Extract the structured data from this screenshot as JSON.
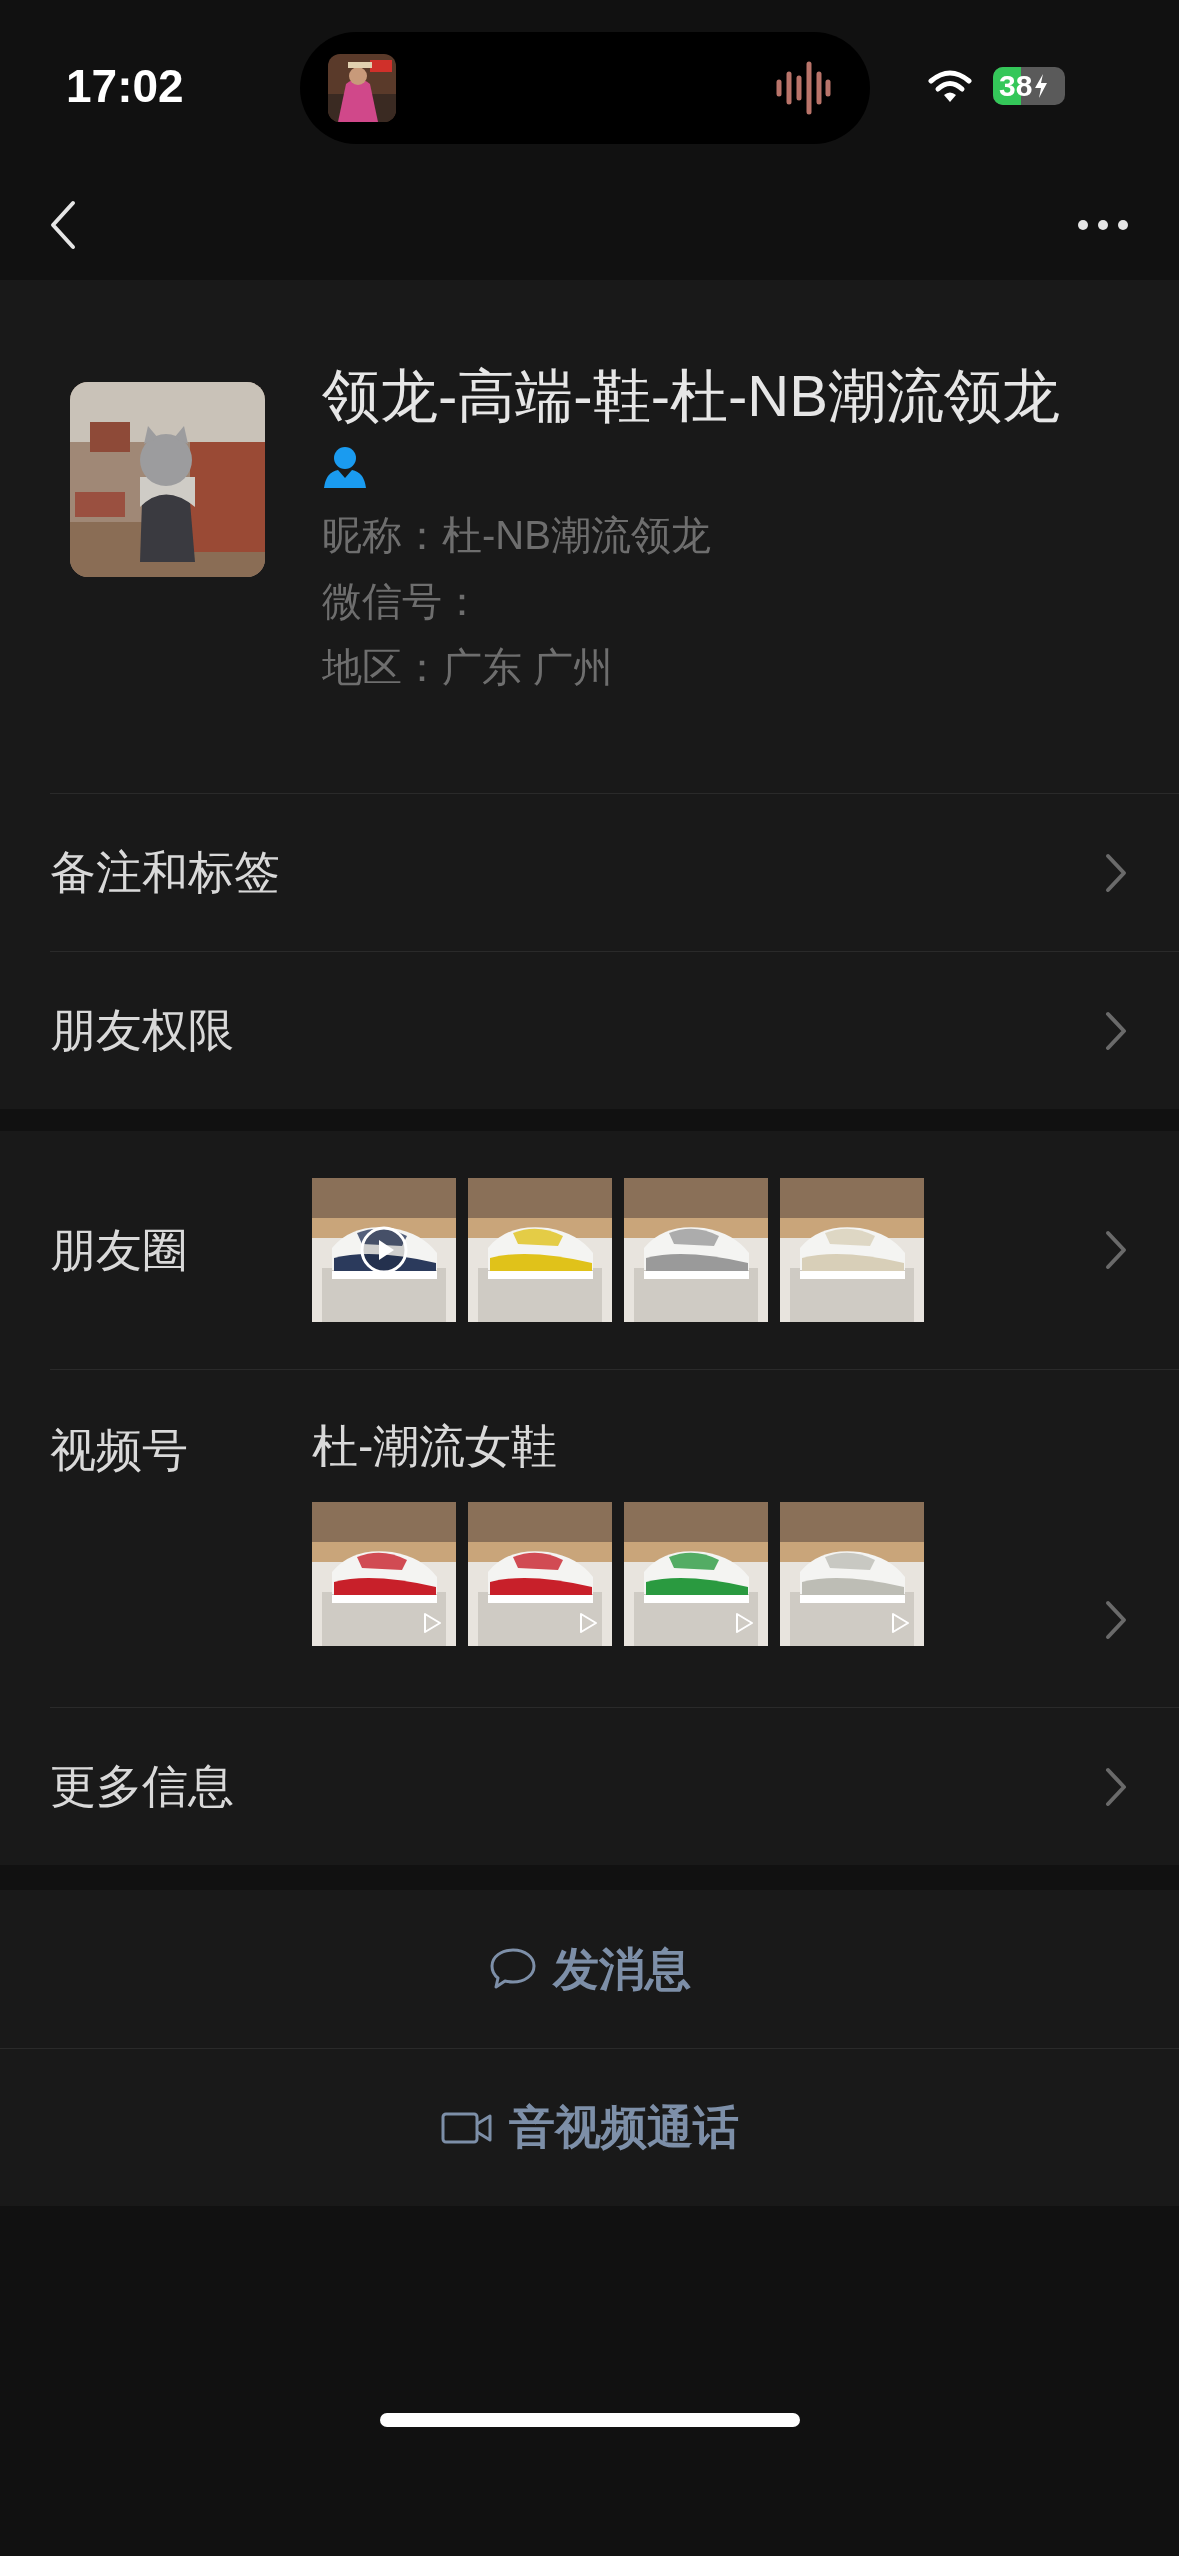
{
  "status_bar": {
    "time": "17:02",
    "battery": "38"
  },
  "profile": {
    "name": "领龙-高端-鞋-杜-NB潮流领龙",
    "details": [
      "昵称：杜-NB潮流领龙",
      "微信号：",
      "地区：广东 广州"
    ]
  },
  "rows": [
    {
      "label": "备注和标签"
    },
    {
      "label": "朋友权限"
    }
  ],
  "moments": {
    "label": "朋友圈",
    "thumbs": [
      {
        "kind": "picture",
        "video": true
      },
      {
        "kind": "picture",
        "video": false
      },
      {
        "kind": "picture",
        "video": false
      },
      {
        "kind": "picture",
        "video": false
      }
    ]
  },
  "channels": {
    "label": "视频号",
    "title": "杜-潮流女鞋",
    "thumbs": [
      {
        "kind": "picture"
      },
      {
        "kind": "picture"
      },
      {
        "kind": "picture"
      },
      {
        "kind": "picture"
      }
    ]
  },
  "more": {
    "label": "更多信息"
  },
  "actions": [
    {
      "kind": "message",
      "label": "发消息"
    },
    {
      "kind": "call",
      "label": "音视频通话"
    }
  ]
}
